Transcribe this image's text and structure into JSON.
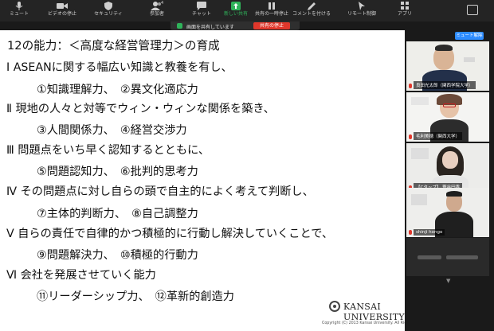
{
  "toolbar": {
    "items": [
      {
        "label": "ミュート",
        "icon": "microphone-icon"
      },
      {
        "label": "ビデオの停止",
        "icon": "video-camera-icon"
      },
      {
        "label": "セキュリティ",
        "icon": "shield-icon"
      },
      {
        "label": "参加者",
        "icon": "participants-icon"
      },
      {
        "label": "チャット",
        "icon": "chat-bubble-icon"
      },
      {
        "label": "新しい共有",
        "icon": "share-arrow-icon"
      },
      {
        "label": "共有の一時停止",
        "icon": "pause-icon"
      },
      {
        "label": "コメントを付ける",
        "icon": "pen-icon"
      },
      {
        "label": "リモート制御",
        "icon": "mouse-pointer-icon"
      },
      {
        "label": "アプリ",
        "icon": "apps-icon"
      }
    ],
    "participant_count": "4"
  },
  "share_banner": {
    "status": "画面を共有しています",
    "stop_label": "共有の停止"
  },
  "slide": {
    "title": "12の能力：＜高度な経営管理力＞の育成",
    "lines": [
      "Ⅰ ASEANに関する幅広い知識と教養を有し、",
      "①知識理解力、　②異文化適応力",
      "Ⅱ 現地の人々と対等でウィン・ウィンな関係を築き、",
      "③人間関係力、　④経営交渉力",
      "Ⅲ 問題点をいち早く認知するとともに、",
      "⑤問題認知力、　⑥批判的思考力",
      "Ⅳ その問題点に対し自らの頭で自主的によく考えて判断し、",
      "⑦主体的判断力、　⑧自己調整力",
      "Ⅴ 自らの責任で自律的かつ積極的に行動し解決していくことで、",
      "⑨問題解決力、　⑩積極的行動力",
      "Ⅵ 会社を発展させていく能力",
      "⑪リーダーシップ力、　⑫革新的創造力"
    ],
    "university": "KANSAI UNIVERSITY",
    "copyright": "Copyright (C) 2013 Kansai University. All Rights Reserved."
  },
  "panel": {
    "mute_all_label": "ミュート解除",
    "participants": [
      {
        "name": "良田光太郎（関西学院大学）"
      },
      {
        "name": "毛利美穂（関西大学）"
      },
      {
        "name": "【Cタップ】 蓑谷円香"
      },
      {
        "name": "shinji hongo"
      }
    ]
  },
  "colors": {
    "share_green": "#2fb35a",
    "stop_red": "#e0372b",
    "zoom_blue": "#2d8cff"
  }
}
